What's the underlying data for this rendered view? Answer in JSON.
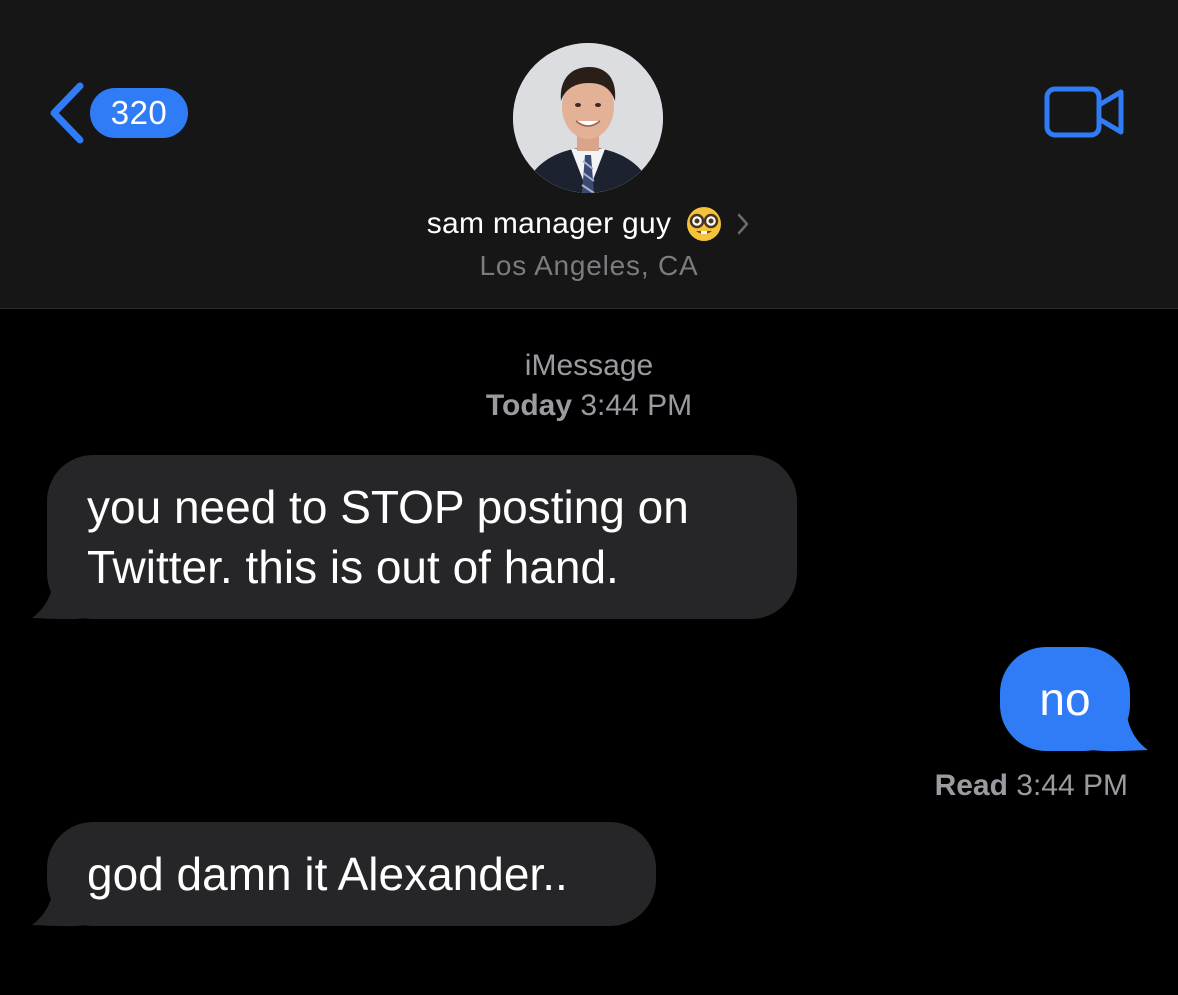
{
  "header": {
    "back_count": "320",
    "contact_name": "sam manager guy",
    "contact_location": "Los Angeles, CA",
    "avatar_icon": "contact-photo",
    "name_emoji_icon": "nerd-face-icon",
    "video_icon": "video-camera-icon",
    "accent_color": "#2f7cf6"
  },
  "conversation": {
    "service": "iMessage",
    "timestamp_day": "Today",
    "timestamp_time": "3:44 PM",
    "messages": [
      {
        "direction": "received",
        "text": "you need to STOP posting on Twitter. this is out of hand."
      },
      {
        "direction": "sent",
        "text": "no"
      },
      {
        "direction": "received",
        "text": "god damn it Alexander.."
      }
    ],
    "read_receipt": {
      "label": "Read",
      "time": "3:44 PM"
    }
  },
  "colors": {
    "background": "#000000",
    "header_background": "#161616",
    "received_bubble": "#262628",
    "sent_bubble": "#2f7cf6",
    "secondary_text": "#9a9aa0"
  }
}
